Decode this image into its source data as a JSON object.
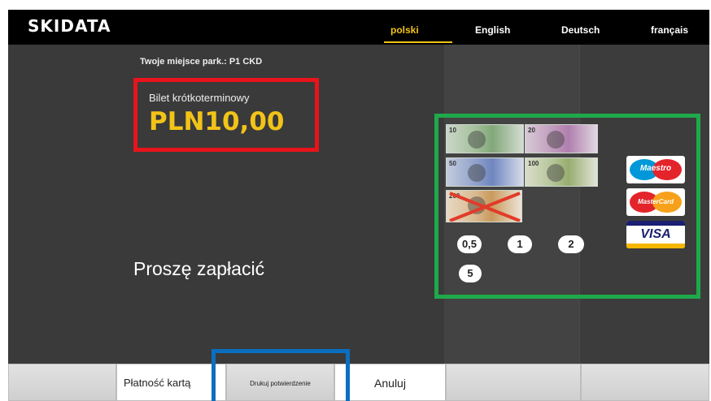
{
  "header": {
    "logo": "SKIDATA",
    "languages": [
      {
        "label": "polski",
        "active": true
      },
      {
        "label": "English",
        "active": false
      },
      {
        "label": "Deutsch",
        "active": false
      },
      {
        "label": "français",
        "active": false
      }
    ]
  },
  "main": {
    "parking_place": "Twoje miejsce park.:  P1 CKD",
    "ticket_type": "Bilet krótkoterminowy",
    "price": "PLN10,00",
    "prompt": "Proszę zapłacić"
  },
  "payment": {
    "banknotes": [
      {
        "denomination": "10",
        "color": "green",
        "accepted": true
      },
      {
        "denomination": "20",
        "color": "pink",
        "accepted": true
      },
      {
        "denomination": "50",
        "color": "blue",
        "accepted": true
      },
      {
        "denomination": "100",
        "color": "olive",
        "accepted": true
      },
      {
        "denomination": "200",
        "color": "orange",
        "accepted": false
      }
    ],
    "coins": [
      "0,5",
      "1",
      "2",
      "5"
    ],
    "cards": [
      "Maestro",
      "MasterCard",
      "VISA"
    ]
  },
  "footer": {
    "buttons": [
      {
        "label": ""
      },
      {
        "label": "Płatność kartą"
      },
      {
        "label": "Drukuj potwierdzenie"
      },
      {
        "label": "Anuluj"
      },
      {
        "label": ""
      },
      {
        "label": ""
      }
    ]
  },
  "colors": {
    "accent_yellow": "#f2c318",
    "highlight_red": "#e8141b",
    "highlight_green": "#1ea94a",
    "highlight_blue": "#0a6fc0",
    "panel_dark": "#3a3a3a"
  }
}
